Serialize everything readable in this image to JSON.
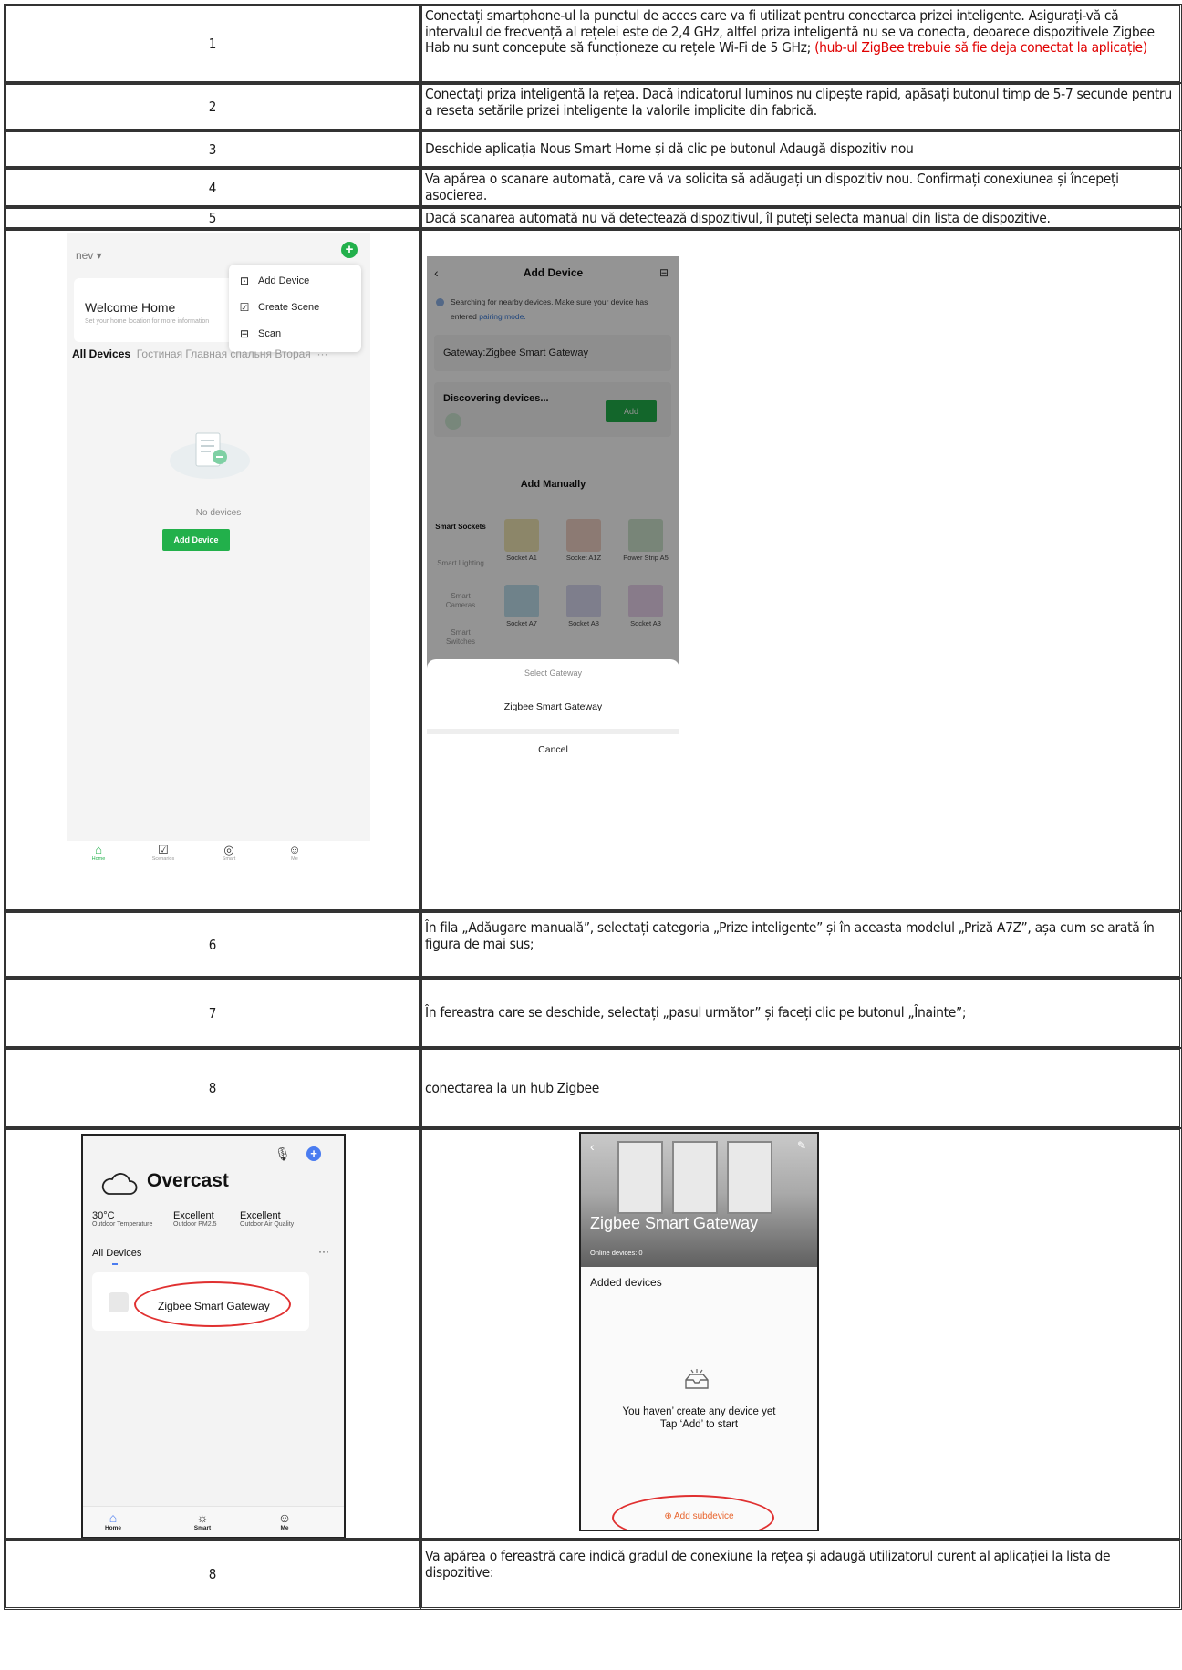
{
  "rows": [
    {
      "num": "1",
      "text": "Conectați smartphone-ul la punctul de acces care va fi utilizat pentru conectarea prizei inteligente. Asigurați-vă că intervalul de frecvență al rețelei este de 2,4 GHz, altfel priza inteligentă nu se va conecta, deoarece dispozitivele Zigbee Hab nu sunt concepute să funcționeze cu rețele Wi-Fi de 5 GHz;",
      "note": "(hub-ul ZigBee trebuie să fie deja conectat la aplicație)"
    },
    {
      "num": "2",
      "text": "Conectați  priza inteligentă  la rețea. Dacă indicatorul luminos nu clipește rapid, apăsați butonul timp de 5-7 secunde pentru a reseta  setările prizei inteligente  la valorile implicite din fabrică."
    },
    {
      "num": "3",
      "text": "Deschide aplicația Nous Smart Home și dă clic pe butonul Adaugă dispozitiv nou"
    },
    {
      "num": "4",
      "text": "Va apărea o scanare automată, care vă va solicita să adăugați un dispozitiv nou. Confirmați conexiunea și începeți asocierea."
    },
    {
      "num": "5",
      "text": "Dacă scanarea automată nu vă detectează dispozitivul, îl puteți selecta manual din lista de dispozitive."
    },
    {
      "num": "6",
      "text": "În fila „Adăugare manuală”, selectați categoria „Prize inteligente” și în aceasta modelul „Priză A7Z”, așa cum se arată în figura de mai sus;"
    },
    {
      "num": "7",
      "text": "În fereastra care se deschide, selectați „pasul următor” și faceți clic pe butonul „Înainte”;"
    },
    {
      "num": "8",
      "text": "conectarea la un hub Zigbee"
    },
    {
      "num": "8",
      "text": "Va apărea o fereastră care indică gradul de conexiune la rețea și adaugă utilizatorul curent al aplicației la lista de dispozitive:"
    }
  ],
  "screen_home": {
    "home_name": "nev ▾",
    "welcome": "Welcome Home",
    "welcome_sub": "Set your home location for more information",
    "menu": [
      "Add Device",
      "Create Scene",
      "Scan"
    ],
    "tabs": {
      "active": "All Devices",
      "rest": "Гостиная   Главная спальня   Вторая",
      "more": "···"
    },
    "no_devices": "No devices",
    "add_button": "Add Device",
    "nav": [
      "Home",
      "Scenarios",
      "Smart",
      "Me"
    ]
  },
  "screen_add": {
    "title": "Add Device",
    "searching": "Searching for nearby devices. Make sure your device has entered",
    "pairing_link": "pairing mode.",
    "gateway": "Gateway:Zigbee Smart Gateway",
    "discovering": "Discovering devices...",
    "add": "Add",
    "manual": "Add Manually",
    "categories": [
      "Smart Sockets",
      "Smart Lighting",
      "Smart Cameras",
      "Smart Switches"
    ],
    "products": [
      "Socket A1",
      "Socket A1Z",
      "Power Strip A5",
      "Socket A7",
      "Socket A8",
      "Socket A3"
    ],
    "sheet_title": "Select Gateway",
    "sheet_option": "Zigbee Smart Gateway",
    "cancel": "Cancel"
  },
  "screen_overcast": {
    "weather": "Overcast",
    "stats": [
      {
        "value": "30°C",
        "label": "Outdoor Temperature"
      },
      {
        "value": "Excellent",
        "label": "Outdoor PM2.5"
      },
      {
        "value": "Excellent",
        "label": "Outdoor Air Quality"
      }
    ],
    "all_devices": "All Devices",
    "more": "···",
    "device": "Zigbee Smart Gateway",
    "nav": [
      "Home",
      "Smart",
      "Me"
    ]
  },
  "screen_gateway": {
    "title": "Zigbee Smart Gateway",
    "online": "Online devices: 0",
    "added": "Added devices",
    "empty_1": "You haven’ create any device yet",
    "empty_2": "Tap ‘Add’ to start",
    "add_sub": "Add subdevice"
  },
  "colors": {
    "accent_green": "#22b04b",
    "accent_blue": "#4a7cf0",
    "note_red": "#e00000",
    "ellipse_red": "#e03030"
  }
}
